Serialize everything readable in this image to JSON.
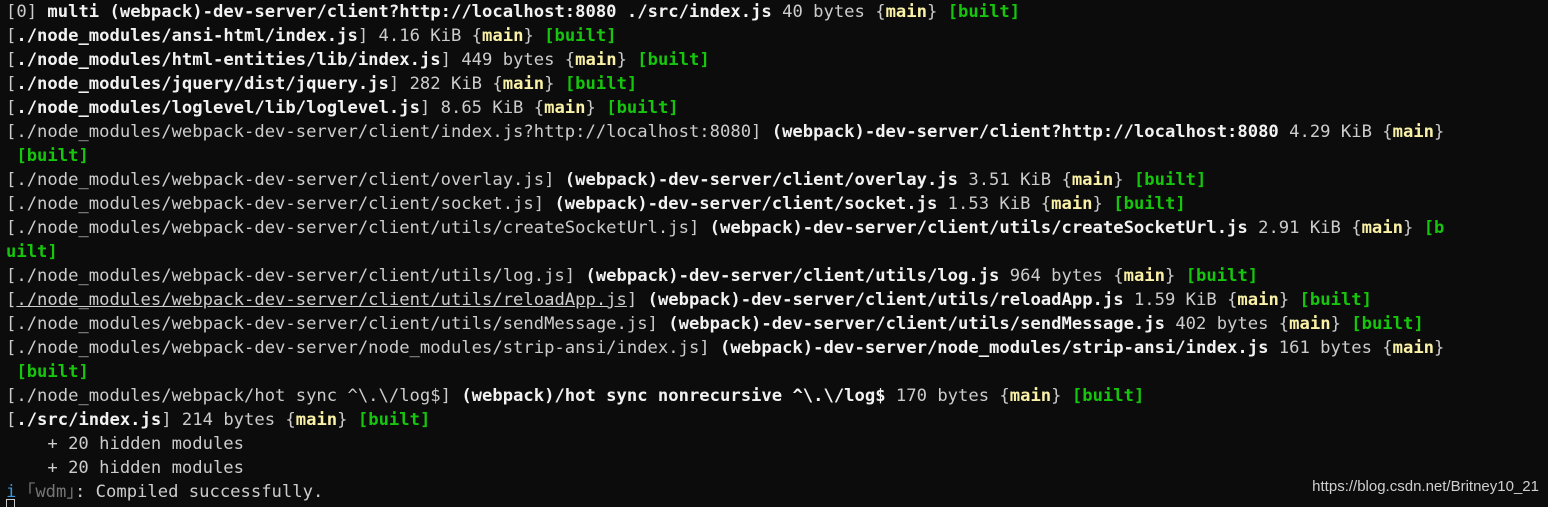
{
  "colors": {
    "background": "#0c0c0c",
    "text": "#cccccc",
    "bold_text": "#f2f2f2",
    "chunk_name": "#f9f1a5",
    "built_tag": "#16c60c",
    "info_icon": "#3a96dd"
  },
  "lines": [
    [
      {
        "t": "[0] "
      },
      {
        "t": "multi (webpack)-dev-server/client?http://localhost:8080 ./src/index.js",
        "s": "b"
      },
      {
        "t": " 40 bytes {"
      },
      {
        "t": "main",
        "s": "y"
      },
      {
        "t": "} "
      },
      {
        "t": "[built]",
        "s": "g"
      }
    ],
    [
      {
        "t": "["
      },
      {
        "t": "./node_modules/ansi-html/index.js",
        "s": "b"
      },
      {
        "t": "] 4.16 KiB {"
      },
      {
        "t": "main",
        "s": "y"
      },
      {
        "t": "} "
      },
      {
        "t": "[built]",
        "s": "g"
      }
    ],
    [
      {
        "t": "["
      },
      {
        "t": "./node_modules/html-entities/lib/index.js",
        "s": "b"
      },
      {
        "t": "] 449 bytes {"
      },
      {
        "t": "main",
        "s": "y"
      },
      {
        "t": "} "
      },
      {
        "t": "[built]",
        "s": "g"
      }
    ],
    [
      {
        "t": "["
      },
      {
        "t": "./node_modules/jquery/dist/jquery.js",
        "s": "b"
      },
      {
        "t": "] 282 KiB {"
      },
      {
        "t": "main",
        "s": "y"
      },
      {
        "t": "} "
      },
      {
        "t": "[built]",
        "s": "g"
      }
    ],
    [
      {
        "t": "["
      },
      {
        "t": "./node_modules/loglevel/lib/loglevel.js",
        "s": "b"
      },
      {
        "t": "] 8.65 KiB {"
      },
      {
        "t": "main",
        "s": "y"
      },
      {
        "t": "} "
      },
      {
        "t": "[built]",
        "s": "g"
      }
    ],
    [
      {
        "t": "[./node_modules/webpack-dev-server/client/index.js?http://localhost:8080] "
      },
      {
        "t": "(webpack)-dev-server/client?http://localhost:8080",
        "s": "b"
      },
      {
        "t": " 4.29 KiB {"
      },
      {
        "t": "main",
        "s": "y"
      },
      {
        "t": "}"
      }
    ],
    [
      {
        "t": " "
      },
      {
        "t": "[built]",
        "s": "g"
      }
    ],
    [
      {
        "t": "[./node_modules/webpack-dev-server/client/overlay.js] "
      },
      {
        "t": "(webpack)-dev-server/client/overlay.js",
        "s": "b"
      },
      {
        "t": " 3.51 KiB {"
      },
      {
        "t": "main",
        "s": "y"
      },
      {
        "t": "} "
      },
      {
        "t": "[built]",
        "s": "g"
      }
    ],
    [
      {
        "t": "[./node_modules/webpack-dev-server/client/socket.js] "
      },
      {
        "t": "(webpack)-dev-server/client/socket.js",
        "s": "b"
      },
      {
        "t": " 1.53 KiB {"
      },
      {
        "t": "main",
        "s": "y"
      },
      {
        "t": "} "
      },
      {
        "t": "[built]",
        "s": "g"
      }
    ],
    [
      {
        "t": "[./node_modules/webpack-dev-server/client/utils/createSocketUrl.js] "
      },
      {
        "t": "(webpack)-dev-server/client/utils/createSocketUrl.js",
        "s": "b"
      },
      {
        "t": " 2.91 KiB {"
      },
      {
        "t": "main",
        "s": "y"
      },
      {
        "t": "} "
      },
      {
        "t": "[b",
        "s": "g"
      }
    ],
    [
      {
        "t": "uilt]",
        "s": "g"
      }
    ],
    [
      {
        "t": "[./node_modules/webpack-dev-server/client/utils/log.js] "
      },
      {
        "t": "(webpack)-dev-server/client/utils/log.js",
        "s": "b"
      },
      {
        "t": " 964 bytes {"
      },
      {
        "t": "main",
        "s": "y"
      },
      {
        "t": "} "
      },
      {
        "t": "[built]",
        "s": "g"
      }
    ],
    [
      {
        "t": "["
      },
      {
        "t": "./node_modules/webpack-dev-server/client/utils/reloadApp.js",
        "s": "u"
      },
      {
        "t": "] "
      },
      {
        "t": "(webpack)-dev-server/client/utils/reloadApp.js",
        "s": "b"
      },
      {
        "t": " 1.59 KiB {"
      },
      {
        "t": "main",
        "s": "y"
      },
      {
        "t": "} "
      },
      {
        "t": "[built]",
        "s": "g"
      }
    ],
    [
      {
        "t": "[./node_modules/webpack-dev-server/client/utils/sendMessage.js] "
      },
      {
        "t": "(webpack)-dev-server/client/utils/sendMessage.js",
        "s": "b"
      },
      {
        "t": " 402 bytes {"
      },
      {
        "t": "main",
        "s": "y"
      },
      {
        "t": "} "
      },
      {
        "t": "[built]",
        "s": "g"
      }
    ],
    [
      {
        "t": "[./node_modules/webpack-dev-server/node_modules/strip-ansi/index.js] "
      },
      {
        "t": "(webpack)-dev-server/node_modules/strip-ansi/index.js",
        "s": "b"
      },
      {
        "t": " 161 bytes {"
      },
      {
        "t": "main",
        "s": "y"
      },
      {
        "t": "}"
      }
    ],
    [
      {
        "t": " "
      },
      {
        "t": "[built]",
        "s": "g"
      }
    ],
    [
      {
        "t": "[./node_modules/webpack/hot sync ^\\.\\/log$] "
      },
      {
        "t": "(webpack)/hot sync nonrecursive ^\\.\\/log$",
        "s": "b"
      },
      {
        "t": " 170 bytes {"
      },
      {
        "t": "main",
        "s": "y"
      },
      {
        "t": "} "
      },
      {
        "t": "[built]",
        "s": "g"
      }
    ],
    [
      {
        "t": "["
      },
      {
        "t": "./src/index.js",
        "s": "b"
      },
      {
        "t": "] 214 bytes {"
      },
      {
        "t": "main",
        "s": "y"
      },
      {
        "t": "} "
      },
      {
        "t": "[built]",
        "s": "g"
      }
    ],
    [
      {
        "t": "    + 20 hidden modules"
      }
    ],
    [
      {
        "t": "    + 20 hidden modules"
      }
    ],
    [
      {
        "t": "i",
        "s": "c"
      },
      {
        "t": " "
      },
      {
        "t": "｢wdm｣",
        "s": "d"
      },
      {
        "t": ": Compiled successfully."
      }
    ]
  ],
  "watermark": "https://blog.csdn.net/Britney10_21"
}
